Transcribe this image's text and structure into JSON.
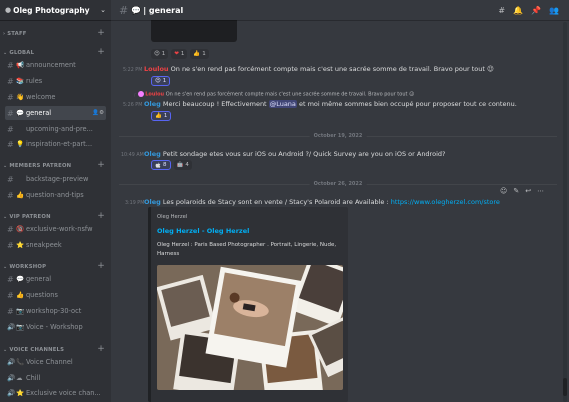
{
  "server": {
    "name": "Oleg Photography",
    "icon": "camera-icon"
  },
  "sidebar": {
    "categories": [
      {
        "label": "STAFF",
        "collapsed": true
      },
      {
        "label": "GLOBAL"
      },
      {
        "label": "MEMBERS PATREON"
      },
      {
        "label": "VIP PATREON"
      },
      {
        "label": "WORKSHOP"
      },
      {
        "label": "VOICE CHANNELS"
      }
    ],
    "channels": [
      {
        "emoji": "📢",
        "label": "announcement"
      },
      {
        "emoji": "📚",
        "label": "rules"
      },
      {
        "emoji": "👋",
        "label": "welcome"
      },
      {
        "emoji": "💬",
        "label": "general",
        "active": true
      },
      {
        "emoji": "",
        "label": "upcoming-and-pre..."
      },
      {
        "emoji": "💡",
        "label": "inspiration-et-part..."
      },
      {
        "emoji": "",
        "label": "backstage-preview"
      },
      {
        "emoji": "👍",
        "label": "question-and-tips"
      },
      {
        "emoji": "🔞",
        "label": "exclusive-work-nsfw"
      },
      {
        "emoji": "⭐",
        "label": "sneakpeek"
      },
      {
        "emoji": "💬",
        "label": "general"
      },
      {
        "emoji": "👍",
        "label": "questions"
      },
      {
        "emoji": "📷",
        "label": "workshop-30-oct"
      },
      {
        "emoji": "📷",
        "label": "Voice - Workshop"
      },
      {
        "emoji": "📞",
        "label": "Voice Channel"
      },
      {
        "emoji": "☁",
        "label": "Chill"
      },
      {
        "emoji": "⭐",
        "label": "Exclusive voice chan..."
      }
    ]
  },
  "topbar": {
    "emoji": "💬",
    "title": "| general",
    "icons": [
      "threads-icon",
      "bell-icon",
      "pin-icon",
      "members-icon"
    ]
  },
  "chat": {
    "top_reactions": [
      {
        "emoji": "😍",
        "count": "1"
      },
      {
        "emoji": "❤",
        "count": "1"
      },
      {
        "emoji": "👍",
        "count": "1"
      }
    ],
    "msg1": {
      "time": "5:22 PM",
      "author": "Loulou",
      "author_color": "#ed4245",
      "text": "On ne s'en rend pas forcément compte mais c'est une sacrée somme de travail. Bravo pour tout 😉",
      "reaction": {
        "emoji": "😍",
        "count": "1"
      }
    },
    "msg2": {
      "reply_text": "On ne s'en rend pas forcément compte mais c'est une sacrée somme de travail. Bravo pour tout 😉",
      "time": "5:26 PM",
      "author": "Oleg",
      "author_color": "#3498db",
      "text_before": "Merci beaucoup !  Effectivement ",
      "mention": "@Luana",
      "text_after": " et moi même sommes bien occupé pour proposer tout ce contenu.",
      "reaction": {
        "emoji": "👍",
        "count": "1"
      }
    },
    "divider1": "October 19, 2022",
    "msg3": {
      "time": "10:49 AM",
      "author": "Oleg",
      "author_color": "#3498db",
      "text": "Petit sondage etes vous sur iOS ou Android ?/ Quick Survey are you on iOS or Android?",
      "reactions": [
        {
          "emoji": "",
          "count": "8"
        },
        {
          "emoji": "🤖",
          "count": "4"
        }
      ]
    },
    "divider2": "October 26, 2022",
    "msg4": {
      "time": "3:19 PM",
      "author": "Oleg",
      "author_color": "#3498db",
      "text": "Les polaroids de Stacy sont en vente /  Stacy's Polaroid are Available : ",
      "link": "https://www.olegherzel.com/store"
    },
    "embed": {
      "provider": "Oleg Herzel",
      "title": "Oleg Herzel - Oleg Herzel",
      "description": "Oleg Herzel : Paris Based Photographer . Portrait, Lingerie, Nude, Harness",
      "image": "polaroid-photos-image"
    },
    "hover_actions": [
      "add-reaction-icon",
      "edit-icon",
      "reply-icon",
      "more-icon"
    ]
  }
}
